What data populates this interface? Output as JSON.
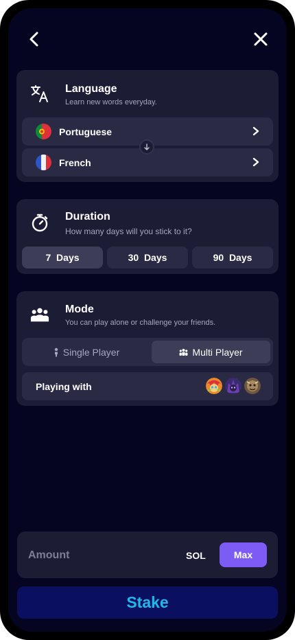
{
  "language": {
    "title": "Language",
    "subtitle": "Learn new words everyday.",
    "from": "Portuguese",
    "to": "French"
  },
  "duration": {
    "title": "Duration",
    "subtitle": "How many days will you stick to it?",
    "options": [
      {
        "num": "7",
        "unit": "Days"
      },
      {
        "num": "30",
        "unit": "Days"
      },
      {
        "num": "90",
        "unit": "Days"
      }
    ],
    "selected_index": 0
  },
  "mode": {
    "title": "Mode",
    "subtitle": "You can play alone or challenge your friends.",
    "single": "Single Player",
    "multi": "Multi Player",
    "selected": "multi",
    "playing_with": "Playing with"
  },
  "amount": {
    "label": "Amount",
    "currency": "SOL",
    "max": "Max"
  },
  "stake": "Stake",
  "colors": {
    "background": "#050522",
    "card": "#1c1c34",
    "accent": "#7d5cf6",
    "stake_text": "#1fb8ea",
    "stake_bg": "#0b0f5f"
  }
}
